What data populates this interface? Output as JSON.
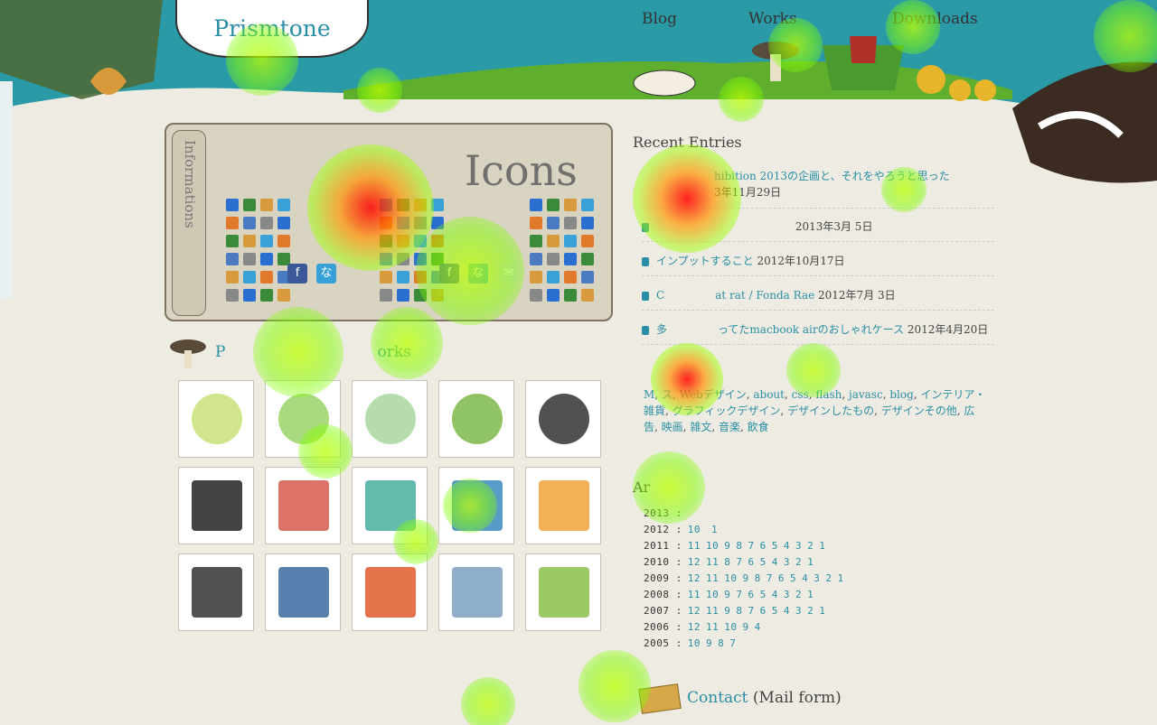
{
  "site": {
    "logo": "Prismtone"
  },
  "nav": {
    "blog": "Blog",
    "works": "Works",
    "downloads": "Downloads"
  },
  "info": {
    "side_label": "Informations",
    "big_title": "Icons"
  },
  "works": {
    "title_partial": "P",
    "title_end": "orks"
  },
  "recent": {
    "title": "Recent Entries",
    "entries": [
      {
        "text": "hibition 2013の企画と、それをやろうと思った",
        "date": "3年11月29日"
      },
      {
        "text": "",
        "date": "2013年3月 5日"
      },
      {
        "text": "インプットすること",
        "date": "2012年10月17日"
      },
      {
        "text": "C",
        "text2": "at rat / Fonda Rae",
        "date": "2012年7月 3日"
      },
      {
        "text": "多",
        "text2": "ってたmacbook airのおしゃれケース",
        "date": "2012年4月20日"
      }
    ]
  },
  "tags": {
    "items": [
      "M",
      "ス",
      "Webデザイン",
      "about",
      "css",
      "flash",
      "javasc",
      "blog",
      "インテリア・雑貨",
      "グラフィックデザイン",
      "デザインしたもの",
      "デザインその他",
      "広告",
      "映画",
      "雑文",
      "音楽",
      "飲食"
    ]
  },
  "archives": {
    "title": "Ar",
    "rows": [
      {
        "year": "2013",
        "months": []
      },
      {
        "year": "2012",
        "months": [
          "10",
          "",
          "1"
        ]
      },
      {
        "year": "2011",
        "months": [
          "11",
          "10",
          "9",
          "8",
          "7",
          "6",
          "5",
          "4",
          "3",
          "2",
          "1"
        ]
      },
      {
        "year": "2010",
        "months": [
          "12",
          "11",
          "8",
          "7",
          "6",
          "5",
          "4",
          "3",
          "2",
          "1"
        ]
      },
      {
        "year": "2009",
        "months": [
          "12",
          "11",
          "10",
          "9",
          "8",
          "7",
          "6",
          "5",
          "4",
          "3",
          "2",
          "1"
        ]
      },
      {
        "year": "2008",
        "months": [
          "11",
          "10",
          "9",
          "7",
          "6",
          "5",
          "4",
          "3",
          "2",
          "1"
        ]
      },
      {
        "year": "2007",
        "months": [
          "12",
          "11",
          "9",
          "8",
          "7",
          "6",
          "5",
          "4",
          "3",
          "2",
          "1"
        ]
      },
      {
        "year": "2006",
        "months": [
          "12",
          "11",
          "10",
          "9",
          "4"
        ]
      },
      {
        "year": "2005",
        "months": [
          "10",
          "9",
          "8",
          "7"
        ]
      }
    ]
  },
  "contact": {
    "link": "Contact",
    "suffix": "(Mail form)"
  },
  "colors": {
    "accent": "#2a8fa6",
    "sky": "#2a9aa6",
    "page": "#edebe2"
  }
}
